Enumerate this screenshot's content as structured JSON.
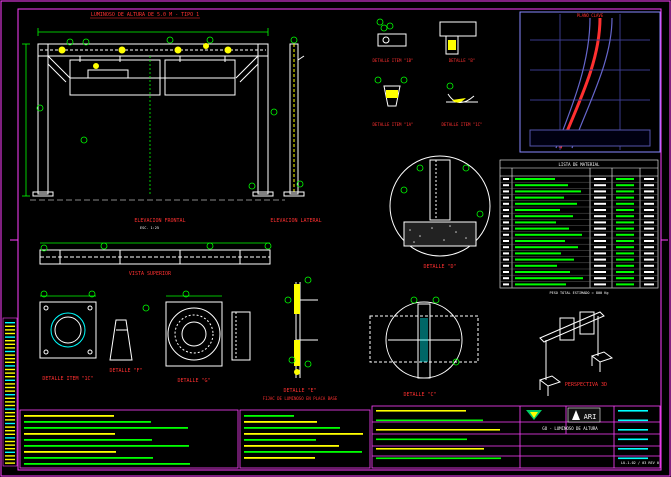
{
  "drawing": {
    "main_title": "LUMINOSO DE ALTURA DE 5.0 M - TIPO 1",
    "views": {
      "elevacion_frontal": "ELEVACION FRONTAL",
      "elevacion_lateral": "ELEVACION LATERAL",
      "vista_superior": "VISTA SUPERIOR",
      "detalle_1a": "DETALLE ITEM \"1A\"",
      "detalle_1b": "DETALLE ITEM \"1B\"",
      "detalle_1c": "DETALLE ITEM \"1C\"",
      "detalle_1c2": "DETALLE ITEM \"1C\"",
      "detalle_b": "DETALLE \"B\"",
      "detalle_c": "DETALLE \"C\"",
      "detalle_d": "DETALLE \"D\"",
      "detalle_e": "DETALLE \"E\"",
      "detalle_f": "DETALLE \"F\"",
      "detalle_g": "DETALLE \"G\"",
      "perspectiva": "PERSPECTIVA 3D",
      "fijacion": "FIJAC DE LUMINOSO EN PLACA BASE",
      "plano_ubicacion": "PLANO CLAVE",
      "escala": "ESC. 1:25"
    },
    "material_list": {
      "title": "LISTA DE MATERIAL",
      "headers": [
        "ITEM",
        "DESCRIPCION",
        "CANT",
        "MATERIAL",
        "PESO"
      ],
      "rows": 18
    },
    "footnote": "PESO TOTAL ESTIMADO = 800 Kg",
    "title_block": {
      "company": "ARI",
      "project": "GO - LUMINOSO DE ALTURA",
      "sheet": "LU-1-02 / 03 REV 0"
    }
  },
  "colors": {
    "background": "#000000",
    "frame": "#ff40ff",
    "geometry": "#ffffff",
    "text_titles": "#ff3030",
    "dimensions": "#00ff00",
    "hidden": "#ffff00",
    "accent": "#00ffff"
  }
}
